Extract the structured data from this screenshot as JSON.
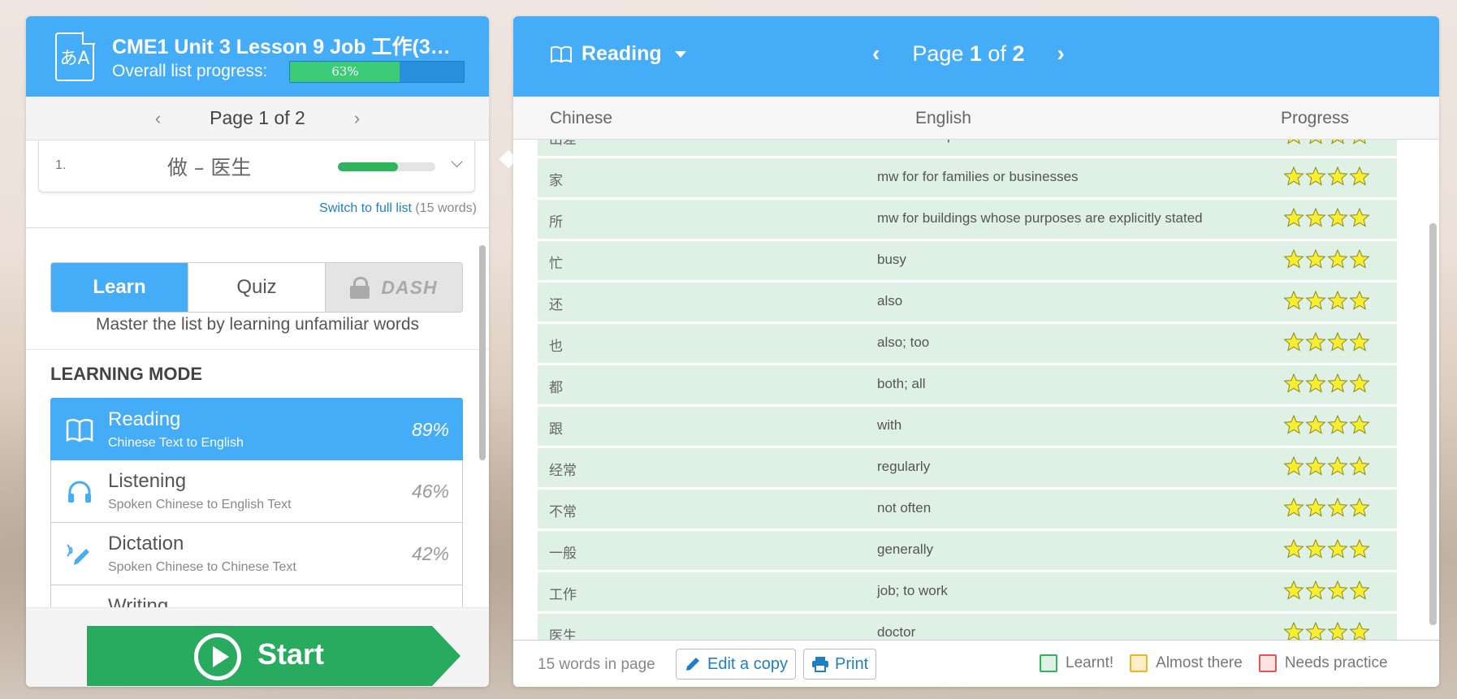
{
  "list": {
    "icon_glyph": "あA",
    "title": "CME1 Unit 3 Lesson 9 Job 工作(3…",
    "progress_label": "Overall list progress:",
    "progress_text": "63%",
    "progress_value": 0.63
  },
  "left_pager": {
    "text": "Page 1 of 2"
  },
  "word_card": {
    "num": "1.",
    "word": "做 – 医生",
    "progress_value": 0.62
  },
  "switch": {
    "link": "Switch to full list",
    "count": "(15 words)"
  },
  "tabs": {
    "learn": "Learn",
    "quiz": "Quiz",
    "dash": "DASH",
    "description": "Master the list by learning unfamiliar words"
  },
  "learning_mode": {
    "heading": "LEARNING MODE",
    "modes": [
      {
        "name": "Reading",
        "sub": "Chinese Text to English",
        "pct": "89%",
        "icon": "book-icon"
      },
      {
        "name": "Listening",
        "sub": "Spoken Chinese to English Text",
        "pct": "46%",
        "icon": "headphones-icon"
      },
      {
        "name": "Dictation",
        "sub": "Spoken Chinese to Chinese Text",
        "pct": "42%",
        "icon": "pen-sound-icon"
      },
      {
        "name": "Writing",
        "sub": "",
        "pct": "",
        "icon": "pen-icon"
      }
    ]
  },
  "start": {
    "label": "Start"
  },
  "right": {
    "mode": "Reading",
    "pager": {
      "prefix": "Page ",
      "current": "1",
      "middle": " of ",
      "total": "2"
    },
    "columns": {
      "chinese": "Chinese",
      "english": "English",
      "progress": "Progress"
    },
    "words": [
      {
        "zh": "出差",
        "en": "business trip",
        "stars": 4
      },
      {
        "zh": "家",
        "en": "mw for for families or businesses",
        "stars": 4
      },
      {
        "zh": "所",
        "en": "mw for buildings whose purposes are explicitly stated",
        "stars": 4
      },
      {
        "zh": "忙",
        "en": "busy",
        "stars": 4
      },
      {
        "zh": "还",
        "en": "also",
        "stars": 4
      },
      {
        "zh": "也",
        "en": "also; too",
        "stars": 4
      },
      {
        "zh": "都",
        "en": "both; all",
        "stars": 4
      },
      {
        "zh": "跟",
        "en": "with",
        "stars": 4
      },
      {
        "zh": "经常",
        "en": "regularly",
        "stars": 4
      },
      {
        "zh": "不常",
        "en": "not often",
        "stars": 4
      },
      {
        "zh": "一般",
        "en": "generally",
        "stars": 4
      },
      {
        "zh": "工作",
        "en": "job; to work",
        "stars": 4
      },
      {
        "zh": "医生",
        "en": "doctor",
        "stars": 4
      }
    ],
    "footer": {
      "words_in_page": "15 words in page",
      "edit": "Edit a copy",
      "print": "Print",
      "legend": [
        {
          "label": "Learnt!",
          "color": "#2eb35e",
          "fill": "#dff0e4"
        },
        {
          "label": "Almost there",
          "color": "#f0b429",
          "fill": "#fdf0c8"
        },
        {
          "label": "Needs practice",
          "color": "#e05555",
          "fill": "#fbe3e3"
        }
      ]
    }
  },
  "colors": {
    "accent": "#45adf7",
    "start": "#29ab5f",
    "learnt_row": "#dff0e4",
    "star": "#f7ee2f"
  }
}
